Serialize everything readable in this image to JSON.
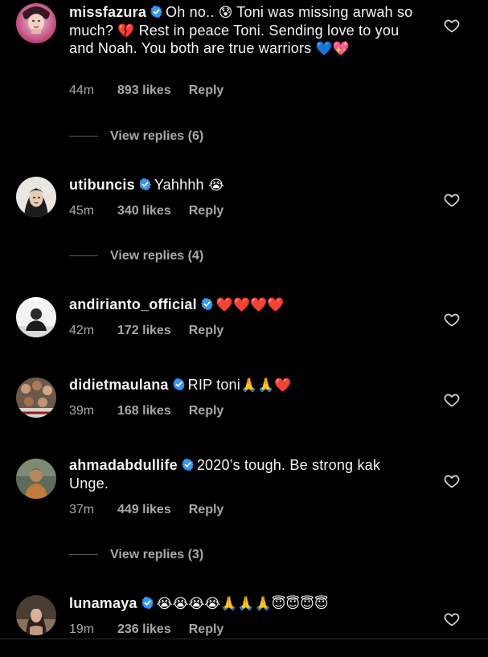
{
  "comments": [
    {
      "username": "missfazura",
      "verified": true,
      "avatar": "avatar-missfazura",
      "segments": [
        {
          "t": "Oh no.. "
        },
        {
          "e": "😰"
        },
        {
          "t": " Toni was missing arwah so much? "
        },
        {
          "e": "💔"
        },
        {
          "t": " Rest in peace Toni. Sending love to you and Noah. You both are true warriors "
        },
        {
          "e": "💙"
        },
        {
          "e": "💖"
        }
      ],
      "time": "44m",
      "likes": "893 likes",
      "reply": "Reply",
      "view_replies": "View replies (6)"
    },
    {
      "username": "utibuncis",
      "verified": true,
      "avatar": "avatar-utibuncis",
      "segments": [
        {
          "t": "Yahhhh "
        },
        {
          "e": "😭"
        }
      ],
      "time": "45m",
      "likes": "340 likes",
      "reply": "Reply",
      "view_replies": "View replies (4)"
    },
    {
      "username": "andirianto_official",
      "verified": true,
      "avatar": "avatar-andirianto",
      "segments": [
        {
          "e": "❤️"
        },
        {
          "e": "❤️"
        },
        {
          "e": "❤️"
        },
        {
          "e": "❤️"
        }
      ],
      "time": "42m",
      "likes": "172 likes",
      "reply": "Reply"
    },
    {
      "username": "didietmaulana",
      "verified": true,
      "avatar": "avatar-didietmaulana",
      "segments": [
        {
          "t": "RIP toni"
        },
        {
          "e": "🙏"
        },
        {
          "e": "🙏"
        },
        {
          "e": "❤️"
        }
      ],
      "time": "39m",
      "likes": "168 likes",
      "reply": "Reply"
    },
    {
      "username": "ahmadabdullife",
      "verified": true,
      "avatar": "avatar-ahmadabdullife",
      "segments": [
        {
          "t": "2020’s tough. Be strong kak Unge."
        }
      ],
      "time": "37m",
      "likes": "449 likes",
      "reply": "Reply",
      "view_replies": "View replies (3)"
    },
    {
      "username": "lunamaya",
      "verified": true,
      "avatar": "avatar-lunamaya",
      "segments": [
        {
          "e": "😭"
        },
        {
          "e": "😭"
        },
        {
          "e": "😭"
        },
        {
          "e": "😭"
        },
        {
          "e": "🙏"
        },
        {
          "e": "🙏"
        },
        {
          "e": "🙏"
        },
        {
          "e": "😇"
        },
        {
          "e": "😇"
        },
        {
          "e": "😇"
        },
        {
          "e": "😇"
        }
      ],
      "time": "19m",
      "likes": "236 likes",
      "reply": "Reply"
    }
  ],
  "colors": {
    "background": "#000000",
    "text": "#f5f5f5",
    "meta": "#a8a8a8",
    "verified": "#3897f0",
    "rule": "#5a5a5a"
  },
  "icons": {
    "like": "heart-outline-icon",
    "verified": "verified-badge-icon"
  }
}
